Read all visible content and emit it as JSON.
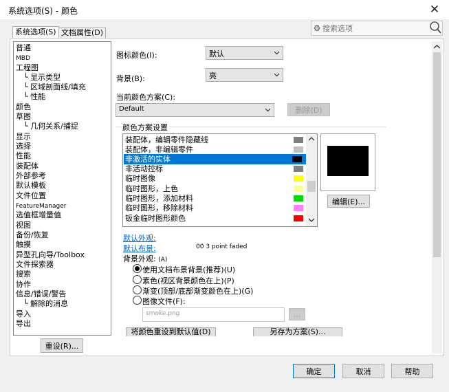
{
  "window": {
    "title": "系统选项(S) - 颜色",
    "close_glyph": "✕"
  },
  "tabs": [
    {
      "label": "系统选项(S)"
    },
    {
      "label": "文档属性(D)"
    }
  ],
  "search": {
    "placeholder": "搜索选项"
  },
  "nav": {
    "items": [
      "普通",
      "MBD",
      "工程图",
      "显示类型",
      "区域剖面线/填充",
      "性能",
      "颜色",
      "草图",
      "几何关系/捕捉",
      "显示",
      "选择",
      "性能",
      "装配体",
      "外部参考",
      "默认模板",
      "文件位置",
      "FeatureManager",
      "选值框增量值",
      "视图",
      "备份/恢复",
      "触摸",
      "异型孔向导/Toolbox",
      "文件探索器",
      "搜索",
      "协作",
      "信息/错误/警告",
      "解除的消息",
      "导入",
      "导出"
    ],
    "selected": "颜色"
  },
  "reset_button": "重设(R)...",
  "icon_color": {
    "label": "图标颜色(I):",
    "value": "默认"
  },
  "background": {
    "label": "背景(B):",
    "value": "亮"
  },
  "scheme": {
    "label": "当前颜色方案(C):",
    "value": "Default",
    "delete_button": "删除(D)"
  },
  "color_settings": {
    "label": "颜色方案设置",
    "items": [
      {
        "label": "装配体，编辑零件隐藏线",
        "color": "#7f7f7f"
      },
      {
        "label": "装配体，非编辑零件",
        "color": "#c0c0c0"
      },
      {
        "label": "非激活的实体",
        "color": "#000000"
      },
      {
        "label": "非活动控标",
        "color": "#808080"
      },
      {
        "label": "临时图像",
        "color": "#ffff00"
      },
      {
        "label": "临时图形，上色",
        "color": "#ffff99"
      },
      {
        "label": "临时图形，添加材料",
        "color": "#00dd00"
      },
      {
        "label": "临时图形，移除材料",
        "color": "#ff80ff"
      },
      {
        "label": "钣金临时图形颜色",
        "color": "#ff0000"
      }
    ],
    "selected_index": 2,
    "edit_button": "编辑(E)...",
    "preview_color": "#000000"
  },
  "default_appearance": {
    "label": "默认外观:"
  },
  "default_scene": {
    "label": "默认布景:",
    "value": "00 3 point faded"
  },
  "background_appearance": {
    "label": "背景外观:",
    "hotkey": "(A)",
    "options": [
      {
        "label": "使用文档布景背景(推荐)(U)",
        "checked": true
      },
      {
        "label": "素色(视区背景颜色在上)(P)",
        "checked": false
      },
      {
        "label": "渐变(顶部/底部渐变颜色在上)(G)",
        "checked": false
      },
      {
        "label": "图像文件(F):",
        "checked": false
      }
    ],
    "image_file": "smoke.png",
    "browse_button": "..."
  },
  "bottom_buttons": {
    "reset_colors": "将颜色重设到默认值(D)",
    "save_as": "另存为方案(S)..."
  },
  "footer": {
    "ok": "确定",
    "cancel": "取消",
    "help": "帮助"
  }
}
